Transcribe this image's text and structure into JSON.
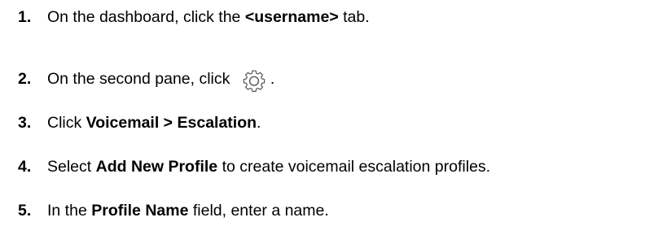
{
  "steps": [
    {
      "number": "1.",
      "text_before": "On the dashboard, click the ",
      "bold": "<username>",
      "text_after": " tab."
    },
    {
      "number": "2.",
      "text_before": "On the second pane, click ",
      "icon": "gear-icon",
      "text_after": "."
    },
    {
      "number": "3.",
      "text_before": "Click ",
      "bold": "Voicemail > Escalation",
      "text_after": "."
    },
    {
      "number": "4.",
      "text_before": "Select ",
      "bold": "Add New Profile",
      "text_after": " to create voicemail escalation profiles."
    },
    {
      "number": "5.",
      "text_before": "In the ",
      "bold": "Profile Name",
      "text_after": " field, enter a name."
    }
  ]
}
